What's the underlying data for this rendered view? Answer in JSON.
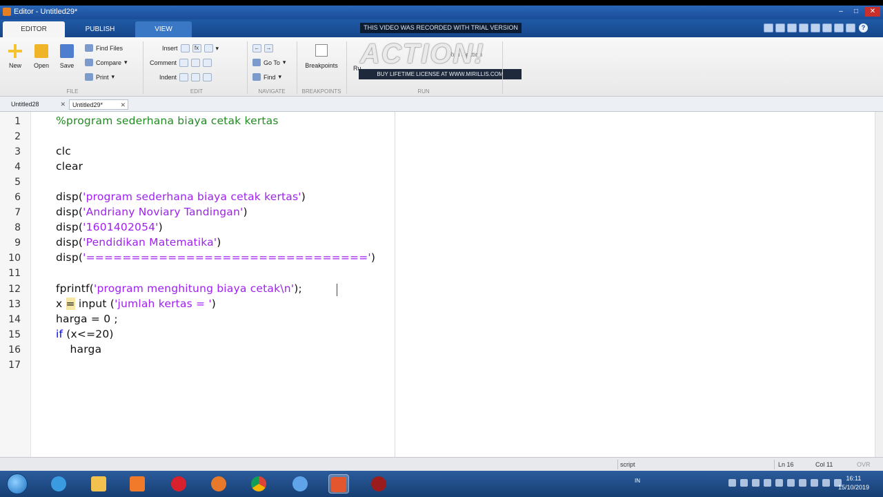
{
  "window": {
    "title": "Editor - Untitled29*"
  },
  "ribbon_tabs": [
    {
      "label": "EDITOR"
    },
    {
      "label": "PUBLISH"
    },
    {
      "label": "VIEW"
    }
  ],
  "trial_banner": "THIS VIDEO WAS RECORDED WITH TRIAL VERSION",
  "watermark": {
    "logo_text": "ACTION!",
    "subtext": "BUY LIFETIME LICENSE AT WWW.MIRILLIS.COM"
  },
  "ribbon": {
    "file": {
      "new_label": "New",
      "open_label": "Open",
      "save_label": "Save",
      "find_files_label": "Find Files",
      "compare_label": "Compare",
      "print_label": "Print",
      "group_label": "FILE"
    },
    "edit": {
      "insert_label": "Insert",
      "comment_label": "Comment",
      "indent_label": "Indent",
      "fx_label": "fx",
      "group_label": "EDIT"
    },
    "navigate": {
      "goto_label": "Go To",
      "find_label": "Find",
      "group_label": "NAVIGATE"
    },
    "breakpoints": {
      "button_label": "Breakpoints",
      "group_label": "BREAKPOINTS"
    },
    "run": {
      "run_label": "Ru",
      "run_section_label": "Run Section",
      "group_label": "RUN"
    }
  },
  "doc_tabs": [
    {
      "label": "Untitled28"
    },
    {
      "label": "Untitled29*"
    }
  ],
  "code": {
    "line_numbers": [
      "1",
      "2",
      "3",
      "4",
      "5",
      "6",
      "7",
      "8",
      "9",
      "10",
      "11",
      "12",
      "13",
      "14",
      "15",
      "16",
      "17"
    ],
    "l1": "%program sederhana biaya cetak kertas",
    "l3": "clc",
    "l4": "clear",
    "l6_fn": "disp(",
    "l6_str": "'program sederhana biaya cetak kertas'",
    "l6_end": ")",
    "l7_fn": "disp(",
    "l7_str": "'Andriany Noviary Tandingan'",
    "l7_end": ")",
    "l8_fn": "disp(",
    "l8_str": "'1601402054'",
    "l8_end": ")",
    "l9_fn": "disp(",
    "l9_str": "'Pendidikan Matematika'",
    "l9_end": ")",
    "l10_fn": "disp(",
    "l10_str": "'==============================='",
    "l10_end": ")",
    "l12_fn": "fprintf(",
    "l12_str": "'program menghitung biaya cetak\\n'",
    "l12_end": ");",
    "l13_a": "x ",
    "l13_eq": "=",
    "l13_b": " input (",
    "l13_str": "'jumlah kertas = '",
    "l13_end": ")",
    "l14": "harga = 0 ;",
    "l15_kw": "if",
    "l15_rest": " (x<=20)",
    "l16": "    harga"
  },
  "status": {
    "mode": "script",
    "line": "Ln  16",
    "col": "Col  11",
    "ovr": "OVR"
  },
  "taskbar": {
    "lang": "IN",
    "time": "16:11",
    "date": "15/10/2019"
  }
}
